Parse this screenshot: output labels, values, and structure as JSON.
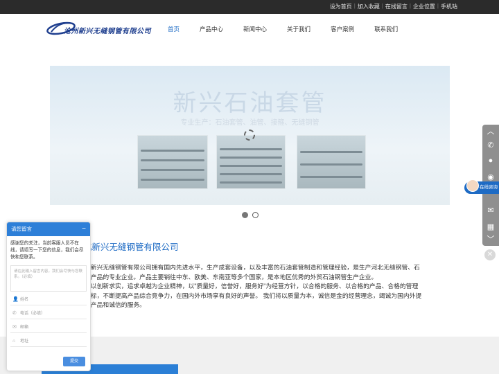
{
  "topbar": {
    "links": [
      "设为首页",
      "加入收藏",
      "在线留言",
      "企业位置",
      "手机站"
    ]
  },
  "header": {
    "logo_text": "沧州新兴无缝钢管有限公司",
    "nav": [
      {
        "label": "首页",
        "active": true
      },
      {
        "label": "产品中心",
        "active": false
      },
      {
        "label": "新闻中心",
        "active": false
      },
      {
        "label": "关于我们",
        "active": false
      },
      {
        "label": "客户案例",
        "active": false
      },
      {
        "label": "联系我们",
        "active": false
      }
    ]
  },
  "banner": {
    "title": "新兴石油套管",
    "subtitle": "专业生产：石油套管、油管、接箍、无缝钢管",
    "slide_count": 2,
    "active_slide": 1
  },
  "about": {
    "title": "北新兴无缝钢管有限公司",
    "lines": [
      "北新兴无缝钢管有限公司拥有国内先进水平，生产成套设备，以及丰富的石油套管制造和管理经验，是生产河北无缝钢管、石",
      "等产品的专业企业。产品主要销往中东、欧美、东南亚等多个国家，是本地区优秀的外贸石油钢管生产企业。",
      "司以创新求实，追求卓越为企业精神，以\"质量好，信誉好，服务好\"为经营方针，以合格的服务、以合格的产品、合格的管理",
      "目标，不断提高产品综合竞争力，在国内外市场享有良好的声誉。 我们将以质量为本，诚信是金的经营理念，竭诚为国内外提",
      "的产品和诚信的服务。"
    ]
  },
  "online_badge": {
    "label": "在线咨询"
  },
  "chat": {
    "title": "请您留言",
    "message": "感谢您的关注，当前客服人员不在线，请填写一下您的信息，我们会尽快和您联系。",
    "textarea_placeholder": "请在此输入留言内容，我们会尽快与您联系。（必填）",
    "fields": [
      {
        "icon": "person-icon",
        "placeholder": "姓名"
      },
      {
        "icon": "phone-icon",
        "placeholder": "电话（必填）"
      },
      {
        "icon": "mail-icon",
        "placeholder": "邮箱"
      },
      {
        "icon": "location-icon",
        "placeholder": "地址"
      }
    ],
    "submit_label": "提交"
  }
}
